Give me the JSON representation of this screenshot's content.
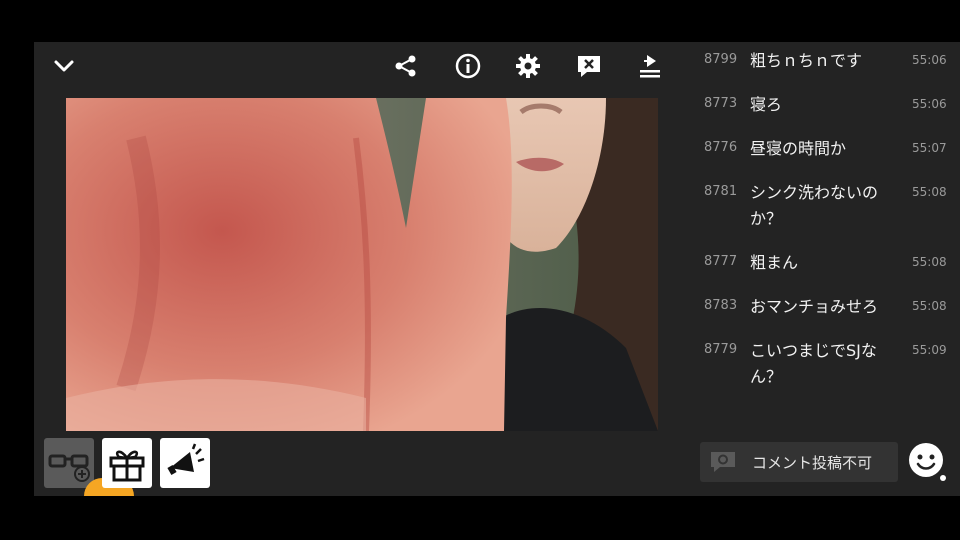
{
  "toolbar": {
    "icons": [
      "chevron-down-icon",
      "share-icon",
      "info-icon",
      "gear-icon",
      "close-comment-icon",
      "upload-icon"
    ]
  },
  "bottom_bar": {
    "icons": [
      "glasses-add-icon",
      "gift-icon",
      "megaphone-icon"
    ]
  },
  "chat": {
    "messages": [
      {
        "num": "8799",
        "text": "粗ちｎちｎです",
        "time": "55:06"
      },
      {
        "num": "8773",
        "text": "寝ろ",
        "time": "55:06"
      },
      {
        "num": "8776",
        "text": "昼寝の時間か",
        "time": "55:07"
      },
      {
        "num": "8781",
        "text": "シンク洗わないのか？",
        "time": "55:08"
      },
      {
        "num": "8777",
        "text": "粗まん",
        "time": "55:08"
      },
      {
        "num": "8783",
        "text": "おマンチョみせろ",
        "time": "55:08"
      },
      {
        "num": "8779",
        "text": "こいつまじでSJなん？",
        "time": "55:09"
      }
    ]
  },
  "comment_input": {
    "label": "コメント投稿不可"
  },
  "colors": {
    "background": "#232323",
    "chat_text": "#f2f2f2",
    "meta_text": "#9a9a9a",
    "accent": "#f5a623"
  }
}
